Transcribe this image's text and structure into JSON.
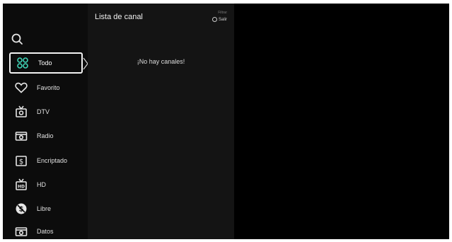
{
  "channel_list": {
    "title": "Lista de canal",
    "filter_hint": "Filtrar",
    "exit_label": "Salir",
    "empty_message": "¡No hay canales!"
  },
  "menu": {
    "items": [
      {
        "label": "Todo",
        "icon": "grid-icon"
      },
      {
        "label": "Favorito",
        "icon": "heart-icon"
      },
      {
        "label": "DTV",
        "icon": "tv-icon"
      },
      {
        "label": "Radio",
        "icon": "radio-icon"
      },
      {
        "label": "Encriptado",
        "icon": "encrypted-icon"
      },
      {
        "label": "HD",
        "icon": "hd-icon"
      },
      {
        "label": "Libre",
        "icon": "free-icon"
      },
      {
        "label": "Datos",
        "icon": "data-icon"
      }
    ],
    "selected_index": 0
  },
  "colors": {
    "background": "#000000",
    "sidebar": "#0c0c0c",
    "panel": "#141414",
    "accent_grid": "#3fd3b6",
    "text": "#e6e6e6"
  }
}
